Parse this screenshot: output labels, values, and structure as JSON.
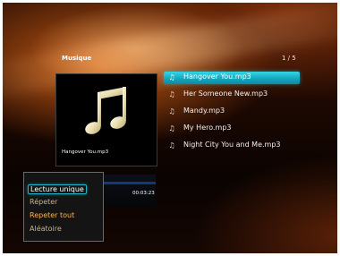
{
  "header": {
    "title": "Musique",
    "page_indicator": "1 / 5"
  },
  "now_playing": {
    "caption": "Hangover You.mp3",
    "elapsed": "00:03:23",
    "progress_fraction": 0.05
  },
  "playlist": [
    {
      "label": "Hangover You.mp3",
      "selected": true
    },
    {
      "label": "Her Someone New.mp3",
      "selected": false
    },
    {
      "label": "Mandy.mp3",
      "selected": false
    },
    {
      "label": "My Hero.mp3",
      "selected": false
    },
    {
      "label": "Night City You and Me.mp3",
      "selected": false
    }
  ],
  "repeat_menu": {
    "items": [
      {
        "label": "Lecture unique",
        "state": "focused"
      },
      {
        "label": "Répeter",
        "state": "normal"
      },
      {
        "label": "Repeter tout",
        "state": "active"
      },
      {
        "label": "Aléatoire",
        "state": "normal"
      }
    ]
  },
  "colors": {
    "highlight": "#1eb6c8",
    "progress": "#2b6fd6",
    "active_option": "#ffb050"
  },
  "icons": {
    "album_art": "music-note-icon",
    "track": "music-note-icon"
  }
}
